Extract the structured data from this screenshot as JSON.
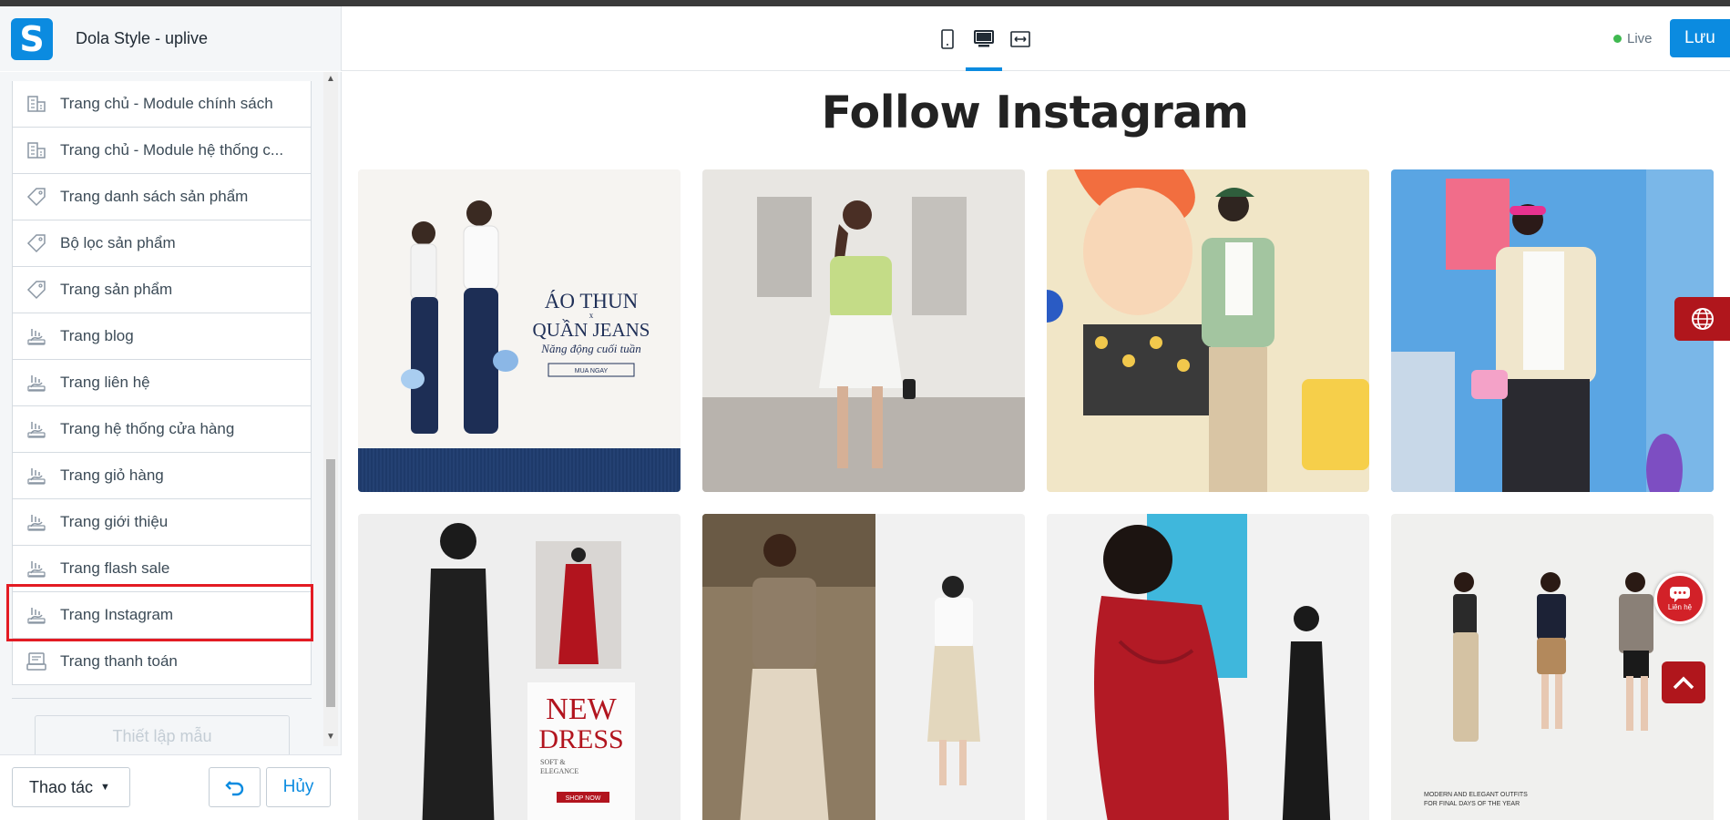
{
  "header": {
    "store_name": "Dola Style - uplive",
    "logo_letter": "S",
    "live_label": "Live",
    "save_label": "Lưu",
    "devices": [
      {
        "name": "mobile-icon"
      },
      {
        "name": "desktop-icon",
        "active": true
      },
      {
        "name": "fullwidth-icon"
      }
    ]
  },
  "sidebar": {
    "items": [
      {
        "label": "Trang chủ - Module chính sách",
        "icon": "store-icon"
      },
      {
        "label": "Trang chủ - Module hệ thống c...",
        "icon": "store-icon"
      },
      {
        "label": "Trang danh sách sản phẩm",
        "icon": "tag-icon"
      },
      {
        "label": "Bộ lọc sản phẩm",
        "icon": "tag-icon"
      },
      {
        "label": "Trang sản phẩm",
        "icon": "tag-icon"
      },
      {
        "label": "Trang blog",
        "icon": "page-icon"
      },
      {
        "label": "Trang liên hệ",
        "icon": "page-icon"
      },
      {
        "label": "Trang hệ thống cửa hàng",
        "icon": "page-icon"
      },
      {
        "label": "Trang giỏ hàng",
        "icon": "page-icon"
      },
      {
        "label": "Trang giới thiệu",
        "icon": "page-icon"
      },
      {
        "label": "Trang flash sale",
        "icon": "page-icon"
      },
      {
        "label": "Trang Instagram",
        "icon": "page-icon",
        "selected": true
      },
      {
        "label": "Trang thanh toán",
        "icon": "checkout-icon"
      }
    ],
    "template_button": "Thiết lập mẫu",
    "actions_label": "Thao tác",
    "cancel_label": "Hủy"
  },
  "preview": {
    "section_title": "Follow Instagram",
    "banner": {
      "line1": "ÁO THUN",
      "line2": "x",
      "line3": "QUẦN JEANS",
      "line4": "Năng động cuối tuần",
      "cta": "MUA NGAY"
    },
    "dress_banner": {
      "line1": "NEW",
      "line2": "DRESS",
      "line3": "SOFT &",
      "line4": "ELEGANCE",
      "cta": "SHOP NOW"
    },
    "outfit_caption": {
      "line1": "MODERN AND ELEGANT OUTFITS",
      "line2": "FOR FINAL DAYS OF THE YEAR"
    },
    "contact_label": "Liên hệ"
  }
}
